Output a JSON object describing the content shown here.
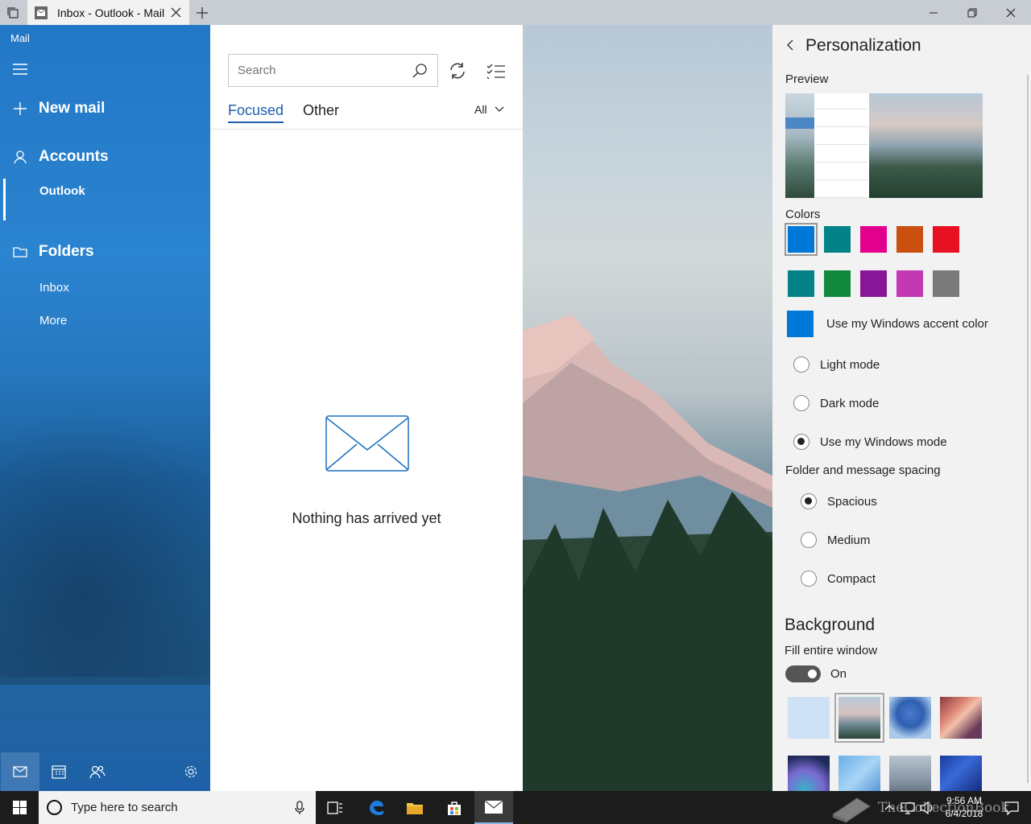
{
  "window": {
    "tab_title": "Inbox - Outlook - Mail",
    "new_tab_icon": "plus-icon",
    "controls": [
      "minimize-icon",
      "restore-icon",
      "close-icon"
    ]
  },
  "nav": {
    "app_name": "Mail",
    "new_mail": "New mail",
    "accounts": "Accounts",
    "account_items": [
      "Outlook"
    ],
    "folders": "Folders",
    "folder_items": [
      "Inbox",
      "More"
    ],
    "bottom_icons": [
      "mail-icon",
      "calendar-icon",
      "people-icon",
      "settings-icon"
    ]
  },
  "list": {
    "search_placeholder": "Search",
    "tabs": {
      "focused": "Focused",
      "other": "Other"
    },
    "filter": "All",
    "empty_message": "Nothing has arrived yet"
  },
  "personalization": {
    "title": "Personalization",
    "preview_label": "Preview",
    "colors_label": "Colors",
    "colors": {
      "row1": [
        "#0078d7",
        "#038387",
        "#e3008c",
        "#ca5010",
        "#e81123"
      ],
      "row2": [
        "#038387",
        "#10893e",
        "#881798",
        "#c239b3",
        "#7a7a7a"
      ],
      "selected": "#0078d7"
    },
    "accent_color": "#0078d7",
    "accent_label": "Use my Windows accent color",
    "modes": [
      {
        "label": "Light mode",
        "checked": false
      },
      {
        "label": "Dark mode",
        "checked": false
      },
      {
        "label": "Use my Windows mode",
        "checked": true
      }
    ],
    "spacing_label": "Folder and message spacing",
    "spacing": [
      {
        "label": "Spacious",
        "checked": true
      },
      {
        "label": "Medium",
        "checked": false
      },
      {
        "label": "Compact",
        "checked": false
      }
    ],
    "background_label": "Background",
    "fill_label": "Fill entire window",
    "fill_state": "On"
  },
  "taskbar": {
    "search_placeholder": "Type here to search",
    "time": "9:56 AM",
    "date": "6/4/2018",
    "watermark": "TheCollectionBook"
  }
}
